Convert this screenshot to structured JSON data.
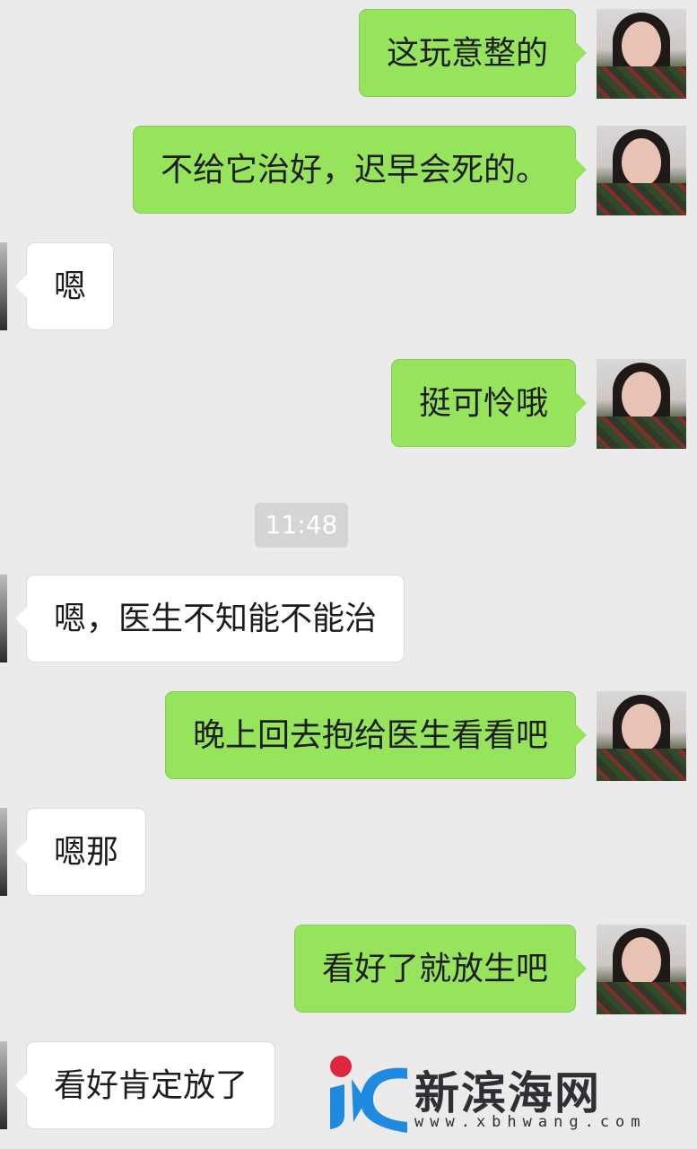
{
  "messages": [
    {
      "side": "me",
      "text": "这玩意整的"
    },
    {
      "side": "me",
      "text": "不给它治好，迟早会死的。"
    },
    {
      "side": "them",
      "text": "嗯"
    },
    {
      "side": "me",
      "text": "挺可怜哦"
    },
    {
      "side": "them",
      "text": "嗯，医生不知能不能治"
    },
    {
      "side": "me",
      "text": "晚上回去抱给医生看看吧"
    },
    {
      "side": "them",
      "text": "嗯那"
    },
    {
      "side": "me",
      "text": "看好了就放生吧"
    },
    {
      "side": "them",
      "text": "看好肯定放了"
    }
  ],
  "timestamp": "11:48",
  "watermark": {
    "name": "新滨海网",
    "url": "www.xbhwang.com"
  },
  "colors": {
    "background": "#ebebeb",
    "my_bubble": "#96e45c",
    "their_bubble": "#ffffff",
    "timestamp_bg": "#d5d5d5"
  }
}
